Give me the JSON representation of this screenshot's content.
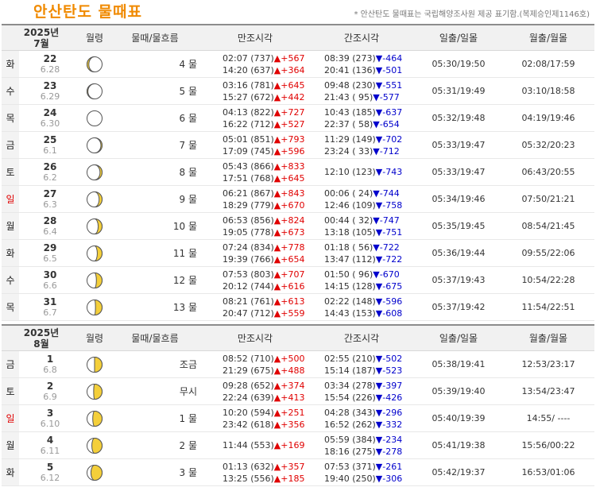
{
  "title": "안산탄도  물때표",
  "note": "* 안산탄도 물때표는 국립해양조사원 제공 표기함.(복제승인제1146호)",
  "headers": {
    "moon_age": "월령",
    "tide": "물때/물흐름",
    "high": "만조시각",
    "low": "간조시각",
    "sun": "일출/일몰",
    "moon": "월출/월몰"
  },
  "colors": {
    "title": "#f08a00",
    "up": "#e00000",
    "down": "#0000cc",
    "moon": "#f4cf3a"
  },
  "months": [
    {
      "year": "2025년",
      "month": "7월",
      "days": [
        {
          "wk": "화",
          "sun": false,
          "day": "22",
          "lunar": "6.28",
          "phase": 0.94,
          "tide": "4 물",
          "high": [
            {
              "t": "02:07 (737)",
              "d": "▲+567",
              "dir": "up"
            },
            {
              "t": "14:20 (637)",
              "d": "▲+364",
              "dir": "up"
            }
          ],
          "low": [
            {
              "t": "08:39 (273)",
              "d": "▼-464",
              "dir": "dn"
            },
            {
              "t": "20:41 (136)",
              "d": "▼-501",
              "dir": "dn"
            }
          ],
          "sunrs": "05:30/19:50",
          "moonrs": "02:08/17:59"
        },
        {
          "wk": "수",
          "sun": false,
          "day": "23",
          "lunar": "6.29",
          "phase": 0.97,
          "tide": "5 물",
          "high": [
            {
              "t": "03:16 (781)",
              "d": "▲+645",
              "dir": "up"
            },
            {
              "t": "15:27 (672)",
              "d": "▲+442",
              "dir": "up"
            }
          ],
          "low": [
            {
              "t": "09:48 (230)",
              "d": "▼-551",
              "dir": "dn"
            },
            {
              "t": "21:43 ( 95)",
              "d": "▼-577",
              "dir": "dn"
            }
          ],
          "sunrs": "05:31/19:49",
          "moonrs": "03:10/18:58"
        },
        {
          "wk": "목",
          "sun": false,
          "day": "24",
          "lunar": "6.30",
          "phase": 0.0,
          "tide": "6 물",
          "high": [
            {
              "t": "04:13 (822)",
              "d": "▲+727",
              "dir": "up"
            },
            {
              "t": "16:22 (712)",
              "d": "▲+527",
              "dir": "up"
            }
          ],
          "low": [
            {
              "t": "10:43 (185)",
              "d": "▼-637",
              "dir": "dn"
            },
            {
              "t": "22:37 ( 58)",
              "d": "▼-654",
              "dir": "dn"
            }
          ],
          "sunrs": "05:32/19:48",
          "moonrs": "04:19/19:46"
        },
        {
          "wk": "금",
          "sun": false,
          "day": "25",
          "lunar": "6.1",
          "phase": 0.04,
          "tide": "7 물",
          "high": [
            {
              "t": "05:01 (851)",
              "d": "▲+793",
              "dir": "up"
            },
            {
              "t": "17:09 (745)",
              "d": "▲+596",
              "dir": "up"
            }
          ],
          "low": [
            {
              "t": "11:29 (149)",
              "d": "▼-702",
              "dir": "dn"
            },
            {
              "t": "23:24 ( 33)",
              "d": "▼-712",
              "dir": "dn"
            }
          ],
          "sunrs": "05:33/19:47",
          "moonrs": "05:32/20:23"
        },
        {
          "wk": "토",
          "sun": false,
          "day": "26",
          "lunar": "6.2",
          "phase": 0.07,
          "tide": "8 물",
          "high": [
            {
              "t": "05:43 (866)",
              "d": "▲+833",
              "dir": "up"
            },
            {
              "t": "17:51 (768)",
              "d": "▲+645",
              "dir": "up"
            }
          ],
          "low": [
            {
              "t": "12:10 (123)",
              "d": "▼-743",
              "dir": "dn"
            }
          ],
          "sunrs": "05:33/19:47",
          "moonrs": "06:43/20:55"
        },
        {
          "wk": "일",
          "sun": true,
          "day": "27",
          "lunar": "6.3",
          "phase": 0.1,
          "tide": "9 물",
          "high": [
            {
              "t": "06:21 (867)",
              "d": "▲+843",
              "dir": "up"
            },
            {
              "t": "18:29 (779)",
              "d": "▲+670",
              "dir": "up"
            }
          ],
          "low": [
            {
              "t": "00:06 ( 24)",
              "d": "▼-744",
              "dir": "dn"
            },
            {
              "t": "12:46 (109)",
              "d": "▼-758",
              "dir": "dn"
            }
          ],
          "sunrs": "05:34/19:46",
          "moonrs": "07:50/21:21"
        },
        {
          "wk": "월",
          "sun": false,
          "day": "28",
          "lunar": "6.4",
          "phase": 0.13,
          "tide": "10 물",
          "high": [
            {
              "t": "06:53 (856)",
              "d": "▲+824",
              "dir": "up"
            },
            {
              "t": "19:05 (778)",
              "d": "▲+673",
              "dir": "up"
            }
          ],
          "low": [
            {
              "t": "00:44 ( 32)",
              "d": "▼-747",
              "dir": "dn"
            },
            {
              "t": "13:18 (105)",
              "d": "▼-751",
              "dir": "dn"
            }
          ],
          "sunrs": "05:35/19:45",
          "moonrs": "08:54/21:45"
        },
        {
          "wk": "화",
          "sun": false,
          "day": "29",
          "lunar": "6.5",
          "phase": 0.16,
          "tide": "11 물",
          "high": [
            {
              "t": "07:24 (834)",
              "d": "▲+778",
              "dir": "up"
            },
            {
              "t": "19:39 (766)",
              "d": "▲+654",
              "dir": "up"
            }
          ],
          "low": [
            {
              "t": "01:18 ( 56)",
              "d": "▼-722",
              "dir": "dn"
            },
            {
              "t": "13:47 (112)",
              "d": "▼-722",
              "dir": "dn"
            }
          ],
          "sunrs": "05:36/19:44",
          "moonrs": "09:55/22:06"
        },
        {
          "wk": "수",
          "sun": false,
          "day": "30",
          "lunar": "6.6",
          "phase": 0.19,
          "tide": "12 물",
          "high": [
            {
              "t": "07:53 (803)",
              "d": "▲+707",
              "dir": "up"
            },
            {
              "t": "20:12 (744)",
              "d": "▲+616",
              "dir": "up"
            }
          ],
          "low": [
            {
              "t": "01:50 ( 96)",
              "d": "▼-670",
              "dir": "dn"
            },
            {
              "t": "14:15 (128)",
              "d": "▼-675",
              "dir": "dn"
            }
          ],
          "sunrs": "05:37/19:43",
          "moonrs": "10:54/22:28"
        },
        {
          "wk": "목",
          "sun": false,
          "day": "31",
          "lunar": "6.7",
          "phase": 0.22,
          "tide": "13 물",
          "high": [
            {
              "t": "08:21 (761)",
              "d": "▲+613",
              "dir": "up"
            },
            {
              "t": "20:47 (712)",
              "d": "▲+559",
              "dir": "up"
            }
          ],
          "low": [
            {
              "t": "02:22 (148)",
              "d": "▼-596",
              "dir": "dn"
            },
            {
              "t": "14:43 (153)",
              "d": "▼-608",
              "dir": "dn"
            }
          ],
          "sunrs": "05:37/19:42",
          "moonrs": "11:54/22:51"
        }
      ]
    },
    {
      "year": "2025년",
      "month": "8월",
      "days": [
        {
          "wk": "금",
          "sun": false,
          "day": "1",
          "lunar": "6.8",
          "phase": 0.25,
          "tide": "조금",
          "high": [
            {
              "t": "08:52 (710)",
              "d": "▲+500",
              "dir": "up"
            },
            {
              "t": "21:29 (675)",
              "d": "▲+488",
              "dir": "up"
            }
          ],
          "low": [
            {
              "t": "02:55 (210)",
              "d": "▼-502",
              "dir": "dn"
            },
            {
              "t": "15:14 (187)",
              "d": "▼-523",
              "dir": "dn"
            }
          ],
          "sunrs": "05:38/19:41",
          "moonrs": "12:53/23:17"
        },
        {
          "wk": "토",
          "sun": false,
          "day": "2",
          "lunar": "6.9",
          "phase": 0.28,
          "tide": "무시",
          "high": [
            {
              "t": "09:28 (652)",
              "d": "▲+374",
              "dir": "up"
            },
            {
              "t": "22:24 (639)",
              "d": "▲+413",
              "dir": "up"
            }
          ],
          "low": [
            {
              "t": "03:34 (278)",
              "d": "▼-397",
              "dir": "dn"
            },
            {
              "t": "15:54 (226)",
              "d": "▼-426",
              "dir": "dn"
            }
          ],
          "sunrs": "05:39/19:40",
          "moonrs": "13:54/23:47"
        },
        {
          "wk": "일",
          "sun": true,
          "day": "3",
          "lunar": "6.10",
          "phase": 0.31,
          "tide": "1 물",
          "high": [
            {
              "t": "10:20 (594)",
              "d": "▲+251",
              "dir": "up"
            },
            {
              "t": "23:42 (618)",
              "d": "▲+356",
              "dir": "up"
            }
          ],
          "low": [
            {
              "t": "04:28 (343)",
              "d": "▼-296",
              "dir": "dn"
            },
            {
              "t": "16:52 (262)",
              "d": "▼-332",
              "dir": "dn"
            }
          ],
          "sunrs": "05:40/19:39",
          "moonrs": "14:55/ ----"
        },
        {
          "wk": "월",
          "sun": false,
          "day": "4",
          "lunar": "6.11",
          "phase": 0.34,
          "tide": "2 물",
          "high": [
            {
              "t": "11:44 (553)",
              "d": "▲+169",
              "dir": "up"
            }
          ],
          "low": [
            {
              "t": "05:59 (384)",
              "d": "▼-234",
              "dir": "dn"
            },
            {
              "t": "18:16 (275)",
              "d": "▼-278",
              "dir": "dn"
            }
          ],
          "sunrs": "05:41/19:38",
          "moonrs": "15:56/00:22"
        },
        {
          "wk": "화",
          "sun": false,
          "day": "5",
          "lunar": "6.12",
          "phase": 0.37,
          "tide": "3 물",
          "high": [
            {
              "t": "01:13 (632)",
              "d": "▲+357",
              "dir": "up"
            },
            {
              "t": "13:25 (556)",
              "d": "▲+185",
              "dir": "up"
            }
          ],
          "low": [
            {
              "t": "07:53 (371)",
              "d": "▼-261",
              "dir": "dn"
            },
            {
              "t": "19:40 (250)",
              "d": "▼-306",
              "dir": "dn"
            }
          ],
          "sunrs": "05:42/19:37",
          "moonrs": "16:53/01:06"
        }
      ]
    }
  ]
}
